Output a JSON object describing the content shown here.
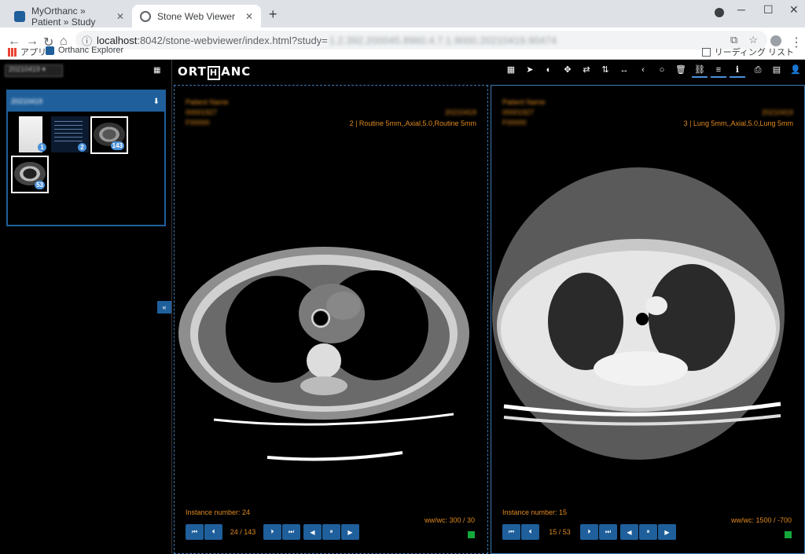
{
  "browser": {
    "tabs": [
      {
        "label": "MyOrthanc » Patient » Study",
        "active": false
      },
      {
        "label": "Stone Web Viewer",
        "active": true
      }
    ],
    "url_host": "localhost",
    "url_path": ":8042/stone-webviewer/index.html?study=",
    "url_study_blurred": "1.2.392.200045.8960.4.7.1.9000.20210419.90474",
    "bookmarks": [
      "アプリ",
      "Orthanc Explorer"
    ],
    "reading_list": "リーディング リスト"
  },
  "sidebar": {
    "patient_select": "20210419 ▾",
    "study": {
      "date_blurred": "20210419",
      "series": [
        {
          "badge": "1",
          "kind": "document"
        },
        {
          "badge": "2",
          "kind": "report"
        },
        {
          "badge": "143",
          "kind": "ct"
        },
        {
          "badge": "53",
          "kind": "ct"
        }
      ]
    },
    "collapse_label": "«"
  },
  "toolbar": {
    "logo_left": "ORT",
    "logo_h": "H",
    "logo_right": "ANC",
    "tools": [
      "layout-icon",
      "pointer-icon",
      "contrast-icon",
      "crosshair-icon",
      "flip-horizontal-icon",
      "flip-vertical-icon",
      "measure-length-icon",
      "angle-icon",
      "circle-icon",
      "trash-icon",
      "link-icon",
      "lines-icon",
      "info-icon",
      "print-icon",
      "download-icon",
      "user-icon"
    ]
  },
  "viewports": [
    {
      "blurred_top_left": [
        "Patient Name",
        "00001927",
        "F00000"
      ],
      "blurred_top_right": "20210419",
      "series_desc": "2 | Routine 5mm,,Axial,5.0,Routine 5mm",
      "instance_label": "Instance number: 24",
      "window": "ww/wc: 300 / 30",
      "counter": "24 / 143",
      "image": "mediastinal-window"
    },
    {
      "blurred_top_left": [
        "Patient Name",
        "00001927",
        "F00000"
      ],
      "blurred_top_right": "20210419",
      "series_desc": "3 | Lung 5mm,,Axial,5.0,Lung 5mm",
      "instance_label": "Instance number: 15",
      "window": "ww/wc: 1500 / -700",
      "counter": "15 / 53",
      "image": "lung-window"
    }
  ],
  "colors": {
    "accent": "#1f5f9b",
    "overlay_text": "#e08a1e",
    "sync_ok": "#14a83a"
  }
}
